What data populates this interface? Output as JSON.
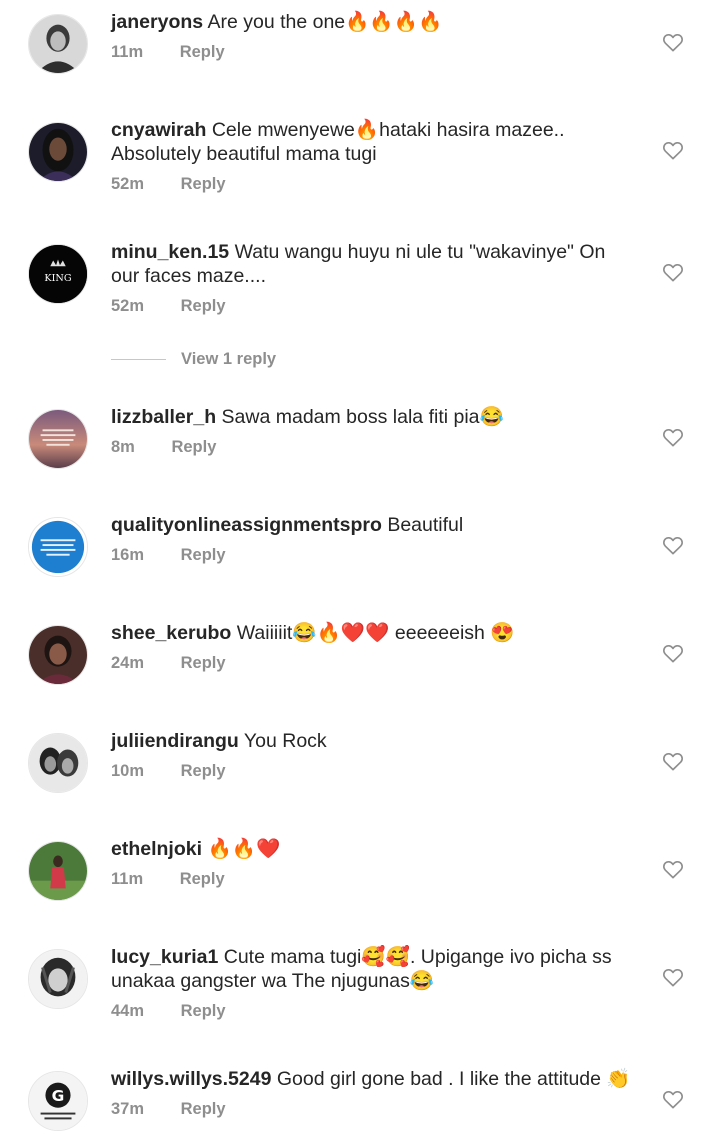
{
  "comments": [
    {
      "username": "janeryons",
      "text": "Are you the one🔥🔥🔥🔥",
      "time": "11m",
      "reply": "Reply",
      "avatar": "woman-portrait-grey"
    },
    {
      "username": "cnyawirah",
      "text": "Cele mwenyewe🔥hataki hasira mazee.. Absolutely beautiful mama tugi",
      "time": "52m",
      "reply": "Reply",
      "avatar": "woman-portrait-dark"
    },
    {
      "username": "minu_ken.15",
      "text": "Watu wangu huyu ni ule tu \"wakavinye\"  On our faces maze....",
      "time": "52m",
      "reply": "Reply",
      "avatar": "king-logo"
    },
    {
      "username": "lizzballer_h",
      "text": "Sawa madam boss lala fiti pia😂",
      "time": "8m",
      "reply": "Reply",
      "avatar": "quote-sunset"
    },
    {
      "username": "qualityonlineassignmentspro",
      "text": "Beautiful",
      "time": "16m",
      "reply": "Reply",
      "avatar": "blue-promo-badge"
    },
    {
      "username": "shee_kerubo",
      "text": "Waiiiiit😂🔥❤️❤️ eeeeeeish 😍",
      "time": "24m",
      "reply": "Reply",
      "avatar": "woman-portrait-brown"
    },
    {
      "username": "juliiendirangu",
      "text": "You Rock",
      "time": "10m",
      "reply": "Reply",
      "avatar": "couple-bw"
    },
    {
      "username": "ethelnjoki",
      "text": "🔥🔥❤️",
      "time": "11m",
      "reply": "Reply",
      "avatar": "woman-garden"
    },
    {
      "username": "lucy_kuria1",
      "text": "Cute mama tugi🥰🥰. Upigange ivo picha ss unakaa gangster wa The njugunas😂",
      "time": "44m",
      "reply": "Reply",
      "avatar": "woman-braids-bw"
    },
    {
      "username": "willys.willys.5249",
      "text": "Good girl gone bad . I like the attitude 👏",
      "time": "37m",
      "reply": "Reply",
      "avatar": "gilbert-construction-logo"
    }
  ],
  "view_replies": {
    "label": "View 1 reply"
  },
  "icons": {
    "like": "heart-outline-icon"
  },
  "logo_text": {
    "king": "KING",
    "gilbert": "GILBERT CONSTRUCTION",
    "promo": "We offer the quickest assignment help online",
    "quote": "I am no longer available for things that make me feel like crap"
  }
}
